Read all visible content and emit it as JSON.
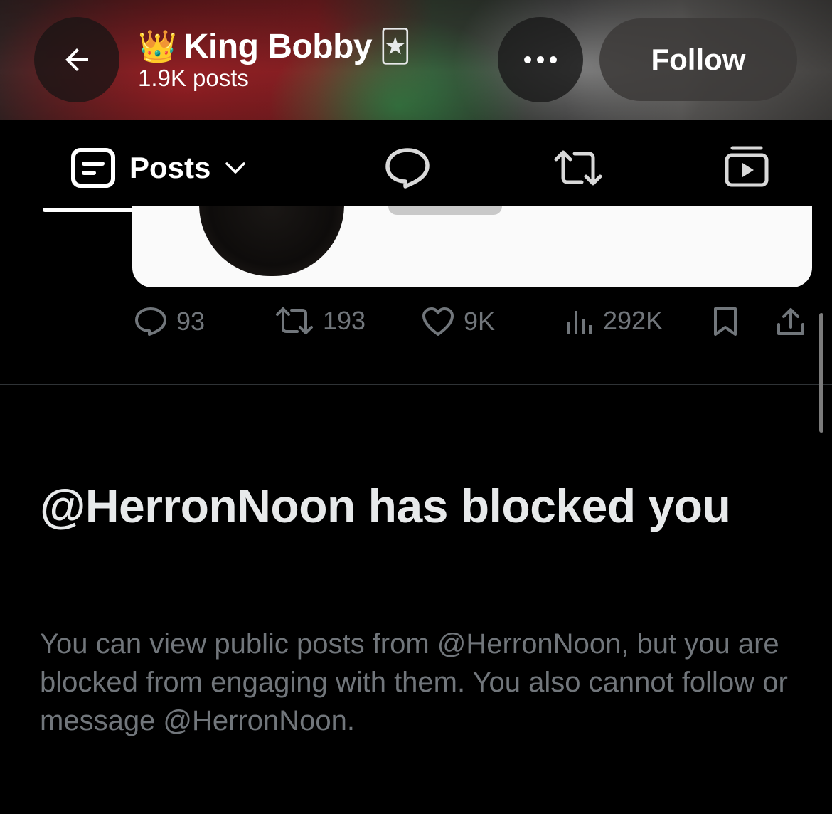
{
  "header": {
    "title": "King Bobby",
    "crown_emoji": "👑",
    "card_emoji": "🃏",
    "subtitle": "1.9K posts",
    "follow_label": "Follow",
    "back_icon": "arrow-left-icon",
    "more_icon": "more-horizontal-icon"
  },
  "tabs": {
    "posts_label": "Posts",
    "items": [
      "posts",
      "replies",
      "reposts",
      "media"
    ]
  },
  "post": {
    "actions": {
      "replies": "93",
      "reposts": "193",
      "likes": "9K",
      "views": "292K"
    }
  },
  "blocked": {
    "title": "@HerronNoon has blocked you",
    "description": "You can view public posts from @HerronNoon, but you are blocked from engaging with them. You also cannot follow or message @HerronNoon."
  },
  "colors": {
    "background": "#000000",
    "text": "#e7e9ea",
    "muted": "#71767b"
  }
}
